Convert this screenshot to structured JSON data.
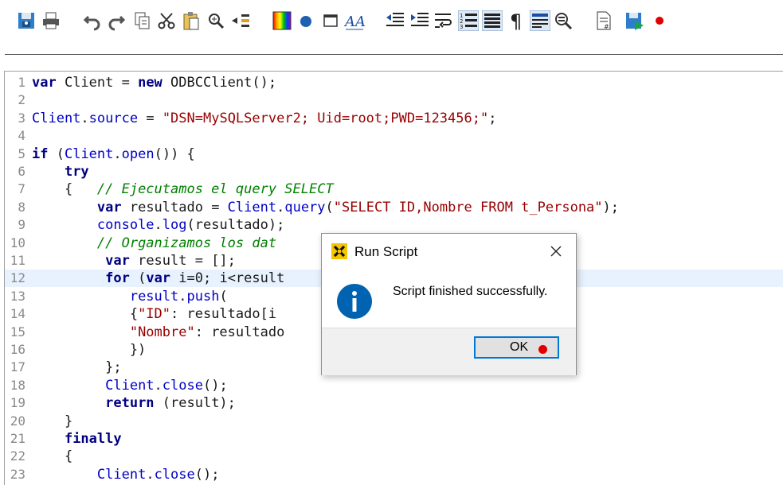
{
  "toolbar": {
    "items": [
      {
        "icon": "save-icon"
      },
      {
        "icon": "print-icon"
      },
      {
        "icon": "undo-icon"
      },
      {
        "icon": "redo-icon"
      },
      {
        "icon": "copy-icon"
      },
      {
        "icon": "cut-icon"
      },
      {
        "icon": "paste-icon"
      },
      {
        "icon": "zoom-icon"
      },
      {
        "icon": "find-icon"
      },
      {
        "icon": "color-icon"
      },
      {
        "icon": "circle-icon"
      },
      {
        "icon": "window-icon"
      },
      {
        "icon": "font-icon"
      },
      {
        "icon": "outdent-icon"
      },
      {
        "icon": "indent-icon"
      },
      {
        "icon": "word-wrap-icon"
      },
      {
        "icon": "line-numbers-icon"
      },
      {
        "icon": "list-icon"
      },
      {
        "icon": "pilcrow-icon"
      },
      {
        "icon": "view-icon"
      },
      {
        "icon": "inspect-icon"
      },
      {
        "icon": "document-icon"
      },
      {
        "icon": "run-script-icon"
      },
      {
        "icon": "record-icon"
      }
    ],
    "accent": "#0078d7"
  },
  "editor": {
    "current_line": 12,
    "lines": [
      {
        "n": "1",
        "tokens": [
          [
            "kw",
            "var"
          ],
          [
            "t",
            " Client = "
          ],
          [
            "kw",
            "new"
          ],
          [
            "t",
            " ODBCClient();"
          ]
        ]
      },
      {
        "n": "2",
        "tokens": []
      },
      {
        "n": "3",
        "tokens": [
          [
            "id",
            "Client"
          ],
          [
            "t",
            "."
          ],
          [
            "id",
            "source"
          ],
          [
            "t",
            " = "
          ],
          [
            "str",
            "\"DSN=MySQLServer2; Uid=root;PWD=123456;\""
          ],
          [
            "t",
            ";"
          ]
        ]
      },
      {
        "n": "4",
        "tokens": []
      },
      {
        "n": "5",
        "tokens": [
          [
            "kw",
            "if"
          ],
          [
            "t",
            " ("
          ],
          [
            "id",
            "Client"
          ],
          [
            "t",
            "."
          ],
          [
            "id",
            "open"
          ],
          [
            "t",
            "()) {"
          ]
        ]
      },
      {
        "n": "6",
        "tokens": [
          [
            "t",
            "    "
          ],
          [
            "kw",
            "try"
          ]
        ]
      },
      {
        "n": "7",
        "tokens": [
          [
            "t",
            "    {   "
          ],
          [
            "cm",
            "// Ejecutamos el query SELECT"
          ]
        ]
      },
      {
        "n": "8",
        "tokens": [
          [
            "t",
            "        "
          ],
          [
            "kw",
            "var"
          ],
          [
            "t",
            " resultado = "
          ],
          [
            "id",
            "Client"
          ],
          [
            "t",
            "."
          ],
          [
            "id",
            "query"
          ],
          [
            "t",
            "("
          ],
          [
            "str",
            "\"SELECT ID,Nombre FROM t_Persona\""
          ],
          [
            "t",
            ");"
          ]
        ]
      },
      {
        "n": "9",
        "tokens": [
          [
            "t",
            "        "
          ],
          [
            "id",
            "console"
          ],
          [
            "t",
            "."
          ],
          [
            "id",
            "log"
          ],
          [
            "t",
            "(resultado);"
          ]
        ]
      },
      {
        "n": "10",
        "tokens": [
          [
            "t",
            "        "
          ],
          [
            "cm",
            "// Organizamos los dat"
          ]
        ]
      },
      {
        "n": "11",
        "tokens": [
          [
            "t",
            "         "
          ],
          [
            "kw",
            "var"
          ],
          [
            "t",
            " result = [];"
          ]
        ]
      },
      {
        "n": "12",
        "tokens": [
          [
            "t",
            "         "
          ],
          [
            "kw",
            "for"
          ],
          [
            "t",
            " ("
          ],
          [
            "kw",
            "var"
          ],
          [
            "t",
            " i=0; i<result"
          ]
        ]
      },
      {
        "n": "13",
        "tokens": [
          [
            "t",
            "            "
          ],
          [
            "id",
            "result"
          ],
          [
            "t",
            "."
          ],
          [
            "id",
            "push"
          ],
          [
            "t",
            "("
          ]
        ]
      },
      {
        "n": "14",
        "tokens": [
          [
            "t",
            "            {"
          ],
          [
            "str",
            "\"ID\""
          ],
          [
            "t",
            ": resultado[i"
          ]
        ]
      },
      {
        "n": "15",
        "tokens": [
          [
            "t",
            "            "
          ],
          [
            "str",
            "\"Nombre\""
          ],
          [
            "t",
            ": resultado"
          ]
        ]
      },
      {
        "n": "16",
        "tokens": [
          [
            "t",
            "            })"
          ]
        ]
      },
      {
        "n": "17",
        "tokens": [
          [
            "t",
            "         };"
          ]
        ]
      },
      {
        "n": "18",
        "tokens": [
          [
            "t",
            "         "
          ],
          [
            "id",
            "Client"
          ],
          [
            "t",
            "."
          ],
          [
            "id",
            "close"
          ],
          [
            "t",
            "();"
          ]
        ]
      },
      {
        "n": "19",
        "tokens": [
          [
            "t",
            "         "
          ],
          [
            "kw",
            "return"
          ],
          [
            "t",
            " (result);"
          ]
        ]
      },
      {
        "n": "20",
        "tokens": [
          [
            "t",
            "    }"
          ]
        ]
      },
      {
        "n": "21",
        "tokens": [
          [
            "t",
            "    "
          ],
          [
            "kw",
            "finally"
          ]
        ]
      },
      {
        "n": "22",
        "tokens": [
          [
            "t",
            "    {"
          ]
        ]
      },
      {
        "n": "23",
        "tokens": [
          [
            "t",
            "        "
          ],
          [
            "id",
            "Client"
          ],
          [
            "t",
            "."
          ],
          [
            "id",
            "close"
          ],
          [
            "t",
            "();"
          ]
        ]
      }
    ]
  },
  "dialog": {
    "title": "Run Script",
    "message": "Script finished successfully.",
    "ok_label": "OK",
    "title_icon": "run-script-icon",
    "message_icon": "info-icon",
    "info_color": "#0063b1"
  }
}
